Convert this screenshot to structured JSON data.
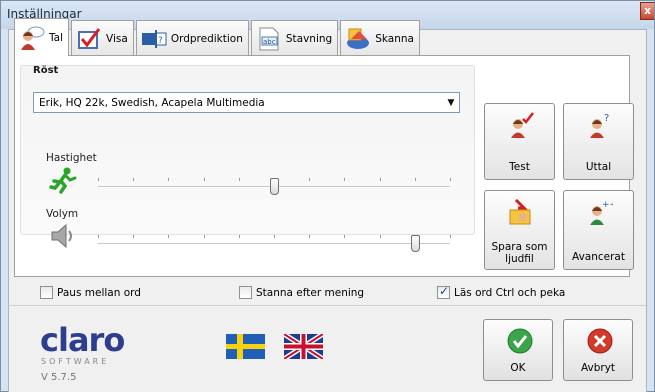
{
  "window": {
    "title": "Inställningar",
    "close_label": "x"
  },
  "tabs": [
    {
      "label": "Tal",
      "icon": "speaker-person-icon"
    },
    {
      "label": "Visa",
      "icon": "checkmark-icon"
    },
    {
      "label": "Ordprediktion",
      "icon": "text-field-icon"
    },
    {
      "label": "Stavning",
      "icon": "spelling-icon"
    },
    {
      "label": "Skanna",
      "icon": "scan-icon"
    }
  ],
  "voice": {
    "group_label": "Röst",
    "selected": "Erik, HQ 22k, Swedish, Acapela Multimedia",
    "speed_label": "Hastighet",
    "speed_value": 0.5,
    "volume_label": "Volym",
    "volume_value": 0.9
  },
  "buttons": {
    "test": "Test",
    "uttal": "Uttal",
    "save_audio_line1": "Spara som",
    "save_audio_line2": "ljudfil",
    "advanced": "Avancerat"
  },
  "options": {
    "pause_words": {
      "label": "Paus mellan ord",
      "checked": false
    },
    "stop_after_sentence": {
      "label": "Stanna efter mening",
      "checked": false
    },
    "read_ctrl_point": {
      "label": "Läs ord Ctrl och peka",
      "checked": true
    }
  },
  "footer": {
    "logo": "claro",
    "logo_sub": "SOFTWARE",
    "version": "V 5.7.5",
    "ok_label": "OK",
    "cancel_label": "Avbryt"
  },
  "colors": {
    "accent": "#2d3e8f",
    "ok_green": "#3aa54a",
    "cancel_red": "#d23a2a"
  }
}
